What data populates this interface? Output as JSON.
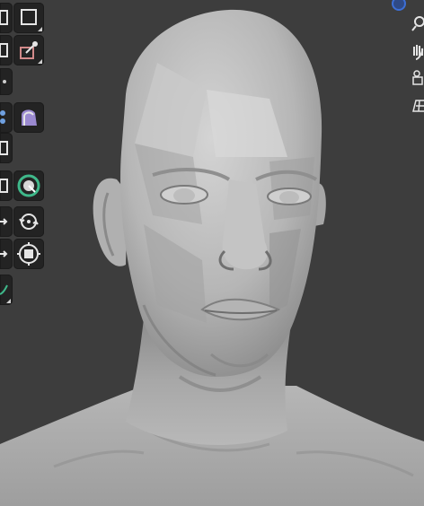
{
  "viewport": {
    "background": "#3d3d3d",
    "model_color": "#bdbdbd",
    "model": "sculpted-male-head-bust"
  },
  "left_toolbar": {
    "tools": [
      {
        "id": "sculpt-draw-partial",
        "icon": "draw-brush-icon"
      },
      {
        "id": "sculpt-clay",
        "icon": "clay-brush-icon"
      },
      {
        "id": "sculpt-inflate-partial",
        "icon": "inflate-brush-icon"
      },
      {
        "id": "sculpt-grab",
        "icon": "grab-brush-icon"
      },
      {
        "id": "sculpt-smooth-partial",
        "icon": "smooth-brush-icon"
      },
      {
        "id": "sculpt-pinch-partial",
        "icon": "pinch-brush-icon"
      },
      {
        "id": "sculpt-flatten",
        "icon": "flatten-brush-icon"
      },
      {
        "id": "sculpt-mask-partial",
        "icon": "mask-brush-icon"
      },
      {
        "id": "sculpt-mask-2-partial",
        "icon": "mask-brush-icon"
      },
      {
        "id": "sculpt-face-set",
        "icon": "face-set-icon"
      },
      {
        "id": "transform-move-partial",
        "icon": "move-icon"
      },
      {
        "id": "transform-rotate",
        "icon": "rotate-icon"
      },
      {
        "id": "transform-scale-partial",
        "icon": "scale-icon"
      },
      {
        "id": "transform-scale",
        "icon": "scale-icon"
      },
      {
        "id": "annotate-partial",
        "icon": "annotate-icon"
      }
    ]
  },
  "navigation": {
    "axis_color": "#3d6fd6",
    "buttons": [
      "zoom-icon",
      "pan-hand-icon",
      "camera-icon",
      "perspective-grid-icon"
    ]
  }
}
